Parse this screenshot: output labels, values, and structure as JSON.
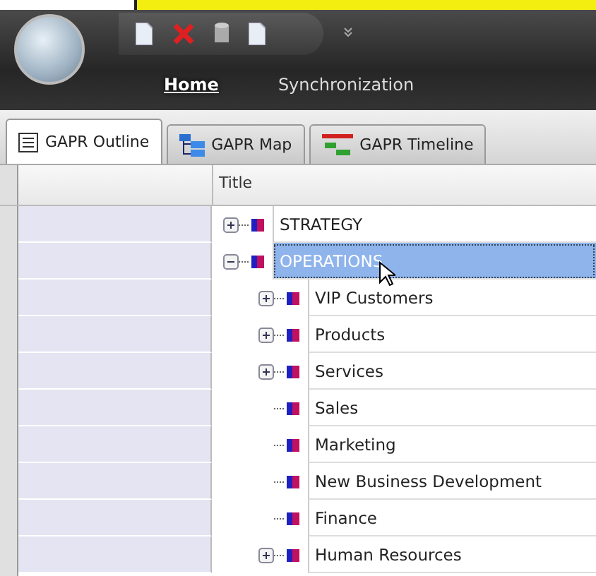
{
  "ribbon": {
    "tabs": [
      {
        "label": "Home",
        "selected": true
      },
      {
        "label": "Synchronization",
        "selected": false
      }
    ]
  },
  "document_tabs": [
    {
      "label": "GAPR Outline",
      "selected": true,
      "kind": "outline"
    },
    {
      "label": "GAPR Map",
      "selected": false,
      "kind": "map"
    },
    {
      "label": "GAPR Timeline",
      "selected": false,
      "kind": "timeline"
    }
  ],
  "grid": {
    "columns": [
      "Title"
    ],
    "items": [
      {
        "title": "STRATEGY",
        "expanded": false,
        "selected": false
      },
      {
        "title": "OPERATIONS",
        "expanded": true,
        "selected": true,
        "children": [
          {
            "title": "VIP Customers",
            "expanded": false,
            "selected": false
          },
          {
            "title": "Products",
            "expanded": false,
            "selected": false
          },
          {
            "title": "Services",
            "expanded": false,
            "selected": false
          },
          {
            "title": "Sales",
            "selected": false
          },
          {
            "title": "Marketing",
            "selected": false
          },
          {
            "title": "New Business Development",
            "selected": false
          },
          {
            "title": "Finance",
            "selected": false
          },
          {
            "title": "Human Resources",
            "expanded": false,
            "selected": false
          }
        ]
      }
    ]
  }
}
